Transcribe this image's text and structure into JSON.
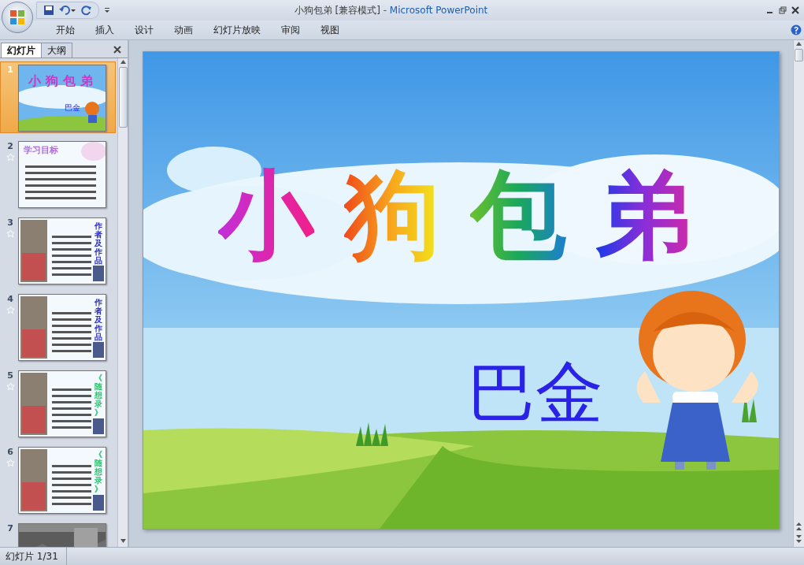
{
  "window": {
    "title": "小狗包弟 [兼容模式]",
    "app": " - Microsoft PowerPoint"
  },
  "ribbon_tabs": [
    {
      "label": "开始"
    },
    {
      "label": "插入"
    },
    {
      "label": "设计"
    },
    {
      "label": "动画"
    },
    {
      "label": "幻灯片放映"
    },
    {
      "label": "审阅"
    },
    {
      "label": "视图"
    }
  ],
  "panel_tabs": [
    {
      "label": "幻灯片",
      "selected": true
    },
    {
      "label": "大纲",
      "selected": false
    }
  ],
  "thumbnails": [
    {
      "number": "1",
      "selected": true,
      "transition": false,
      "kind": "title",
      "title": "小狗包弟",
      "subtitle": "巴金"
    },
    {
      "number": "2",
      "selected": false,
      "transition": true,
      "kind": "objectives",
      "heading": "学习目标"
    },
    {
      "number": "3",
      "selected": false,
      "transition": true,
      "kind": "side",
      "heading": "作者及作品"
    },
    {
      "number": "4",
      "selected": false,
      "transition": true,
      "kind": "side",
      "heading": "作者及作品"
    },
    {
      "number": "5",
      "selected": false,
      "transition": true,
      "kind": "side",
      "heading": "《随想录》"
    },
    {
      "number": "6",
      "selected": false,
      "transition": true,
      "kind": "side",
      "heading": "《随想录》"
    },
    {
      "number": "7",
      "selected": false,
      "transition": false
    }
  ],
  "slide": {
    "title": "小狗包弟",
    "author": "巴金"
  },
  "status_bar": {
    "slide_count": "幻灯片 1/31"
  }
}
